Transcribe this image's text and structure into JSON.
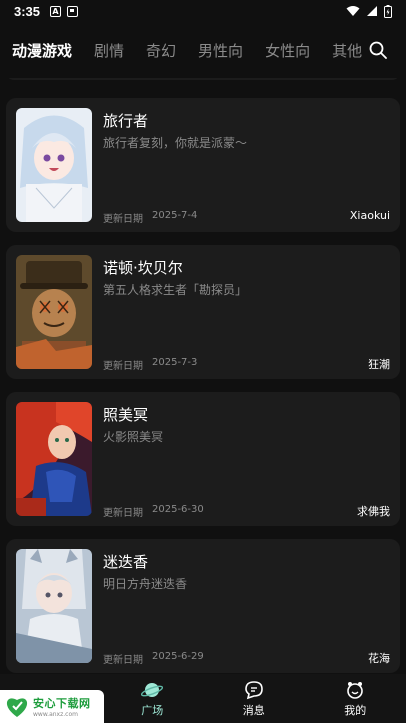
{
  "status": {
    "time": "3:35",
    "icon_a": "A"
  },
  "nav": {
    "tabs": [
      {
        "label": "动漫游戏",
        "active": true
      },
      {
        "label": "剧情"
      },
      {
        "label": "奇幻"
      },
      {
        "label": "男性向"
      },
      {
        "label": "女性向"
      },
      {
        "label": "其他"
      }
    ],
    "search_icon": "search-icon"
  },
  "cards": [
    {
      "title": "旅行者",
      "desc": "旅行者复刻，你就是派蒙～",
      "date_label": "更新日期",
      "date": "2025-7-4",
      "author": "Xiaokui"
    },
    {
      "title": "诺顿·坎贝尔",
      "desc": "第五人格求生者「勘探员」",
      "date_label": "更新日期",
      "date": "2025-7-3",
      "author": "狂潮"
    },
    {
      "title": "照美冥",
      "desc": "火影照美冥",
      "date_label": "更新日期",
      "date": "2025-6-30",
      "author": "求佛我"
    },
    {
      "title": "迷迭香",
      "desc": "明日方舟迷迭香",
      "date_label": "更新日期",
      "date": "2025-6-29",
      "author": "花海"
    }
  ],
  "bottom_nav": [
    {
      "label": "",
      "icon": "home-icon"
    },
    {
      "label": "广场",
      "icon": "planet-icon",
      "active": true
    },
    {
      "label": "消息",
      "icon": "chat-icon"
    },
    {
      "label": "我的",
      "icon": "profile-icon"
    }
  ],
  "watermark": {
    "main": "安心下载网",
    "url": "www.anxz.com"
  },
  "colors": {
    "background": "#101010",
    "card": "#1c1c1c",
    "accent": "#9ee8d6",
    "muted": "#8a8a8a"
  }
}
